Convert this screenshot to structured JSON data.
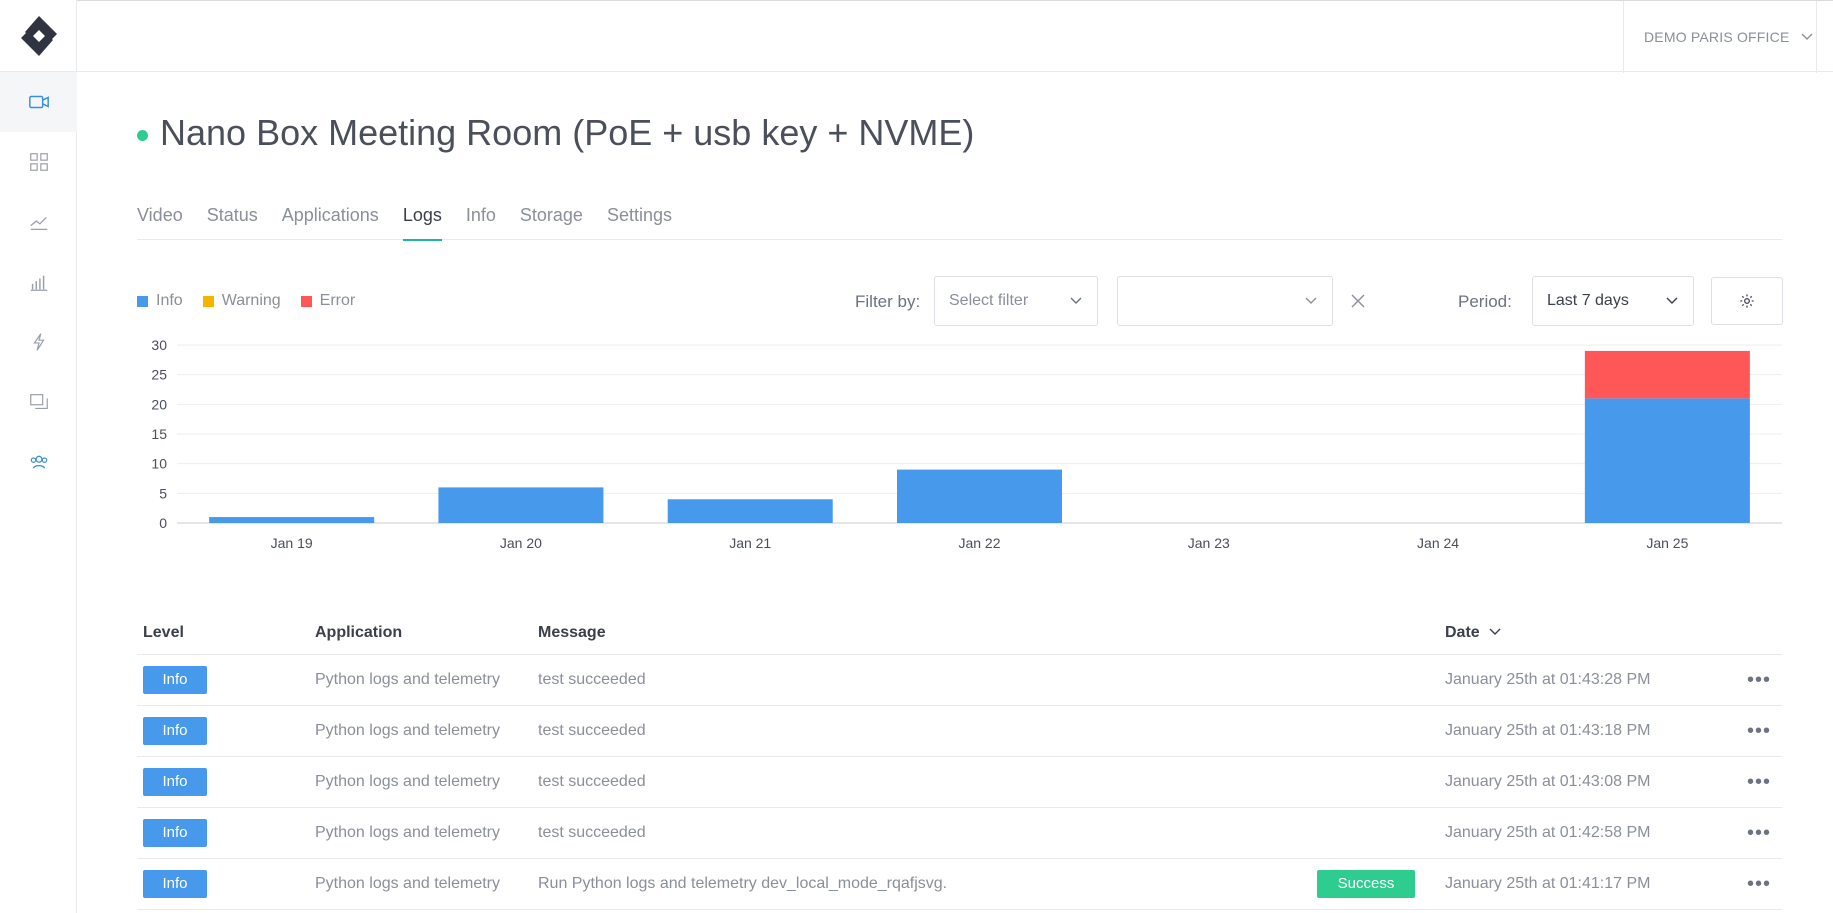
{
  "org": {
    "name": "DEMO PARIS OFFICE"
  },
  "page": {
    "title": "Nano Box Meeting Room (PoE + usb key + NVME)",
    "status_color": "#2ecc8f"
  },
  "tabs": [
    {
      "label": "Video"
    },
    {
      "label": "Status"
    },
    {
      "label": "Applications"
    },
    {
      "label": "Logs",
      "active": true
    },
    {
      "label": "Info"
    },
    {
      "label": "Storage"
    },
    {
      "label": "Settings"
    }
  ],
  "legend": [
    {
      "label": "Info",
      "color": "#4799eb"
    },
    {
      "label": "Warning",
      "color": "#f5b400"
    },
    {
      "label": "Error",
      "color": "#ff5757"
    }
  ],
  "filters": {
    "label": "Filter by:",
    "select_placeholder": "Select filter",
    "value": "",
    "period_label": "Period:",
    "period_value": "Last 7 days"
  },
  "chart_data": {
    "type": "bar",
    "stacked": true,
    "categories": [
      "Jan 19",
      "Jan 20",
      "Jan 21",
      "Jan 22",
      "Jan 23",
      "Jan 24",
      "Jan 25"
    ],
    "series": [
      {
        "name": "Info",
        "color": "#4799eb",
        "values": [
          1,
          6,
          4,
          9,
          0,
          0,
          21
        ]
      },
      {
        "name": "Warning",
        "color": "#f5b400",
        "values": [
          0,
          0,
          0,
          0,
          0,
          0,
          0
        ]
      },
      {
        "name": "Error",
        "color": "#ff5757",
        "values": [
          0,
          0,
          0,
          0,
          0,
          0,
          8
        ]
      }
    ],
    "yticks": [
      0,
      5,
      10,
      15,
      20,
      25,
      30
    ],
    "ylim": [
      0,
      30
    ],
    "grid": true,
    "legend": "top-left"
  },
  "table": {
    "headers": {
      "level": "Level",
      "application": "Application",
      "message": "Message",
      "date": "Date"
    },
    "rows": [
      {
        "level": "Info",
        "application": "Python logs and telemetry",
        "message": "test succeeded",
        "badge": "",
        "date": "January 25th at 01:43:28 PM"
      },
      {
        "level": "Info",
        "application": "Python logs and telemetry",
        "message": "test succeeded",
        "badge": "",
        "date": "January 25th at 01:43:18 PM"
      },
      {
        "level": "Info",
        "application": "Python logs and telemetry",
        "message": "test succeeded",
        "badge": "",
        "date": "January 25th at 01:43:08 PM"
      },
      {
        "level": "Info",
        "application": "Python logs and telemetry",
        "message": "test succeeded",
        "badge": "",
        "date": "January 25th at 01:42:58 PM"
      },
      {
        "level": "Info",
        "application": "Python logs and telemetry",
        "message": "Run Python logs and telemetry dev_local_mode_rqafjsvg.",
        "badge": "Success",
        "date": "January 25th at 01:41:17 PM"
      }
    ]
  },
  "icons": {
    "sidebar": [
      "video-camera-icon",
      "dashboard-grid-icon",
      "trend-line-icon",
      "bar-chart-icon",
      "lightning-icon",
      "screens-icon",
      "users-group-icon"
    ],
    "top": [
      "bell-icon",
      "user-icon"
    ]
  }
}
